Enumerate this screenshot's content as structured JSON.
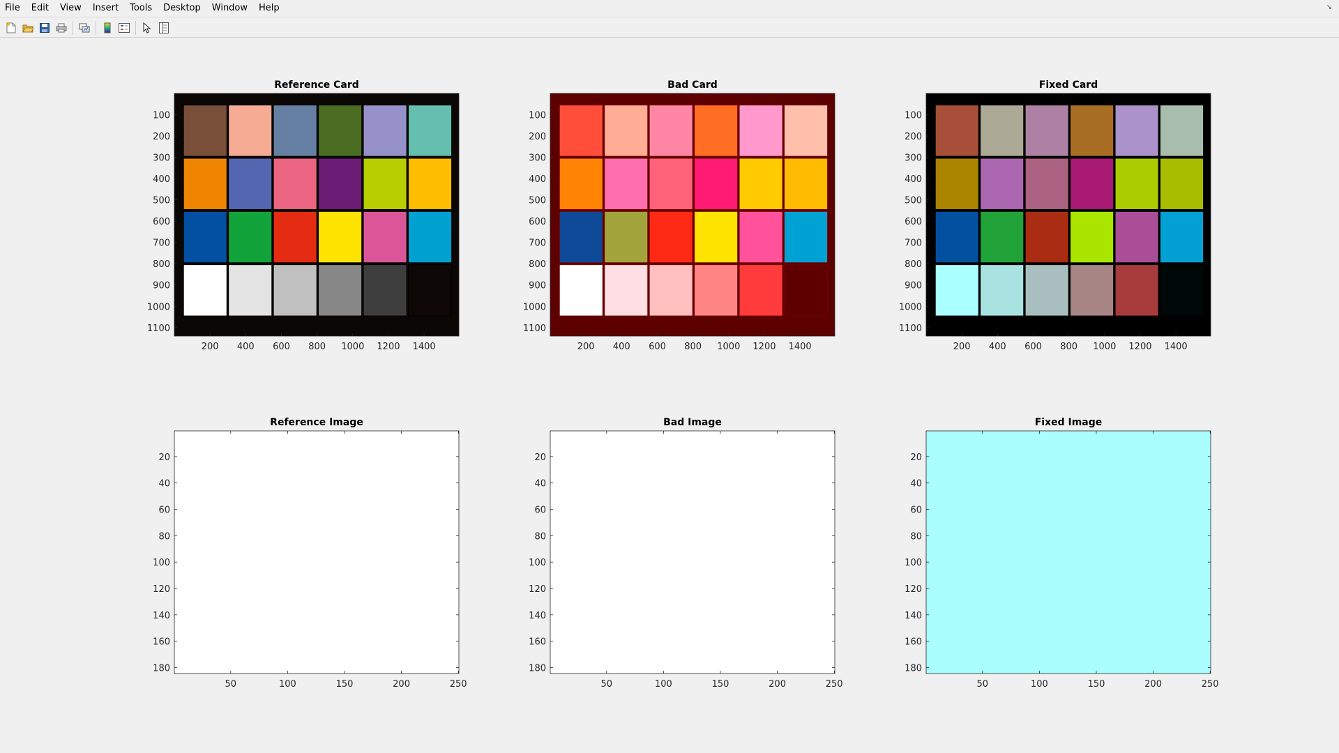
{
  "menu": [
    "File",
    "Edit",
    "View",
    "Insert",
    "Tools",
    "Desktop",
    "Window",
    "Help"
  ],
  "toolbar": {
    "buttons": [
      "new-figure-icon",
      "open-file-icon",
      "save-icon",
      "print-icon",
      "link-plot-icon",
      "colorbar-icon",
      "legend-icon",
      "pointer-icon",
      "property-inspector-icon"
    ]
  },
  "cards": [
    {
      "title": "Reference Card",
      "frame_color": "#0b0704",
      "colors": [
        [
          "#7a4f39",
          "#f6ab95",
          "#6680a4",
          "#4a6d21",
          "#9692c9",
          "#65bfae"
        ],
        [
          "#ef8500",
          "#5566b0",
          "#eb6482",
          "#6b1c74",
          "#b8ce00",
          "#ffbd00"
        ],
        [
          "#034fa1",
          "#12a33b",
          "#e32c12",
          "#ffe300",
          "#db5699",
          "#00a1d1"
        ],
        [
          "#ffffff",
          "#e4e4e4",
          "#c0c0c0",
          "#878787",
          "#3e3e3e",
          "#0d0805"
        ]
      ],
      "xticks": [
        "200",
        "400",
        "600",
        "800",
        "1000",
        "1200",
        "1400"
      ],
      "yticks": [
        "100",
        "200",
        "300",
        "400",
        "500",
        "600",
        "700",
        "800",
        "900",
        "1000",
        "1100"
      ]
    },
    {
      "title": "Bad Card",
      "frame_color": "#5c0000",
      "colors": [
        [
          "#ff4f3b",
          "#ffad95",
          "#ff87a5",
          "#ff6e22",
          "#ff99cd",
          "#ffbfab"
        ],
        [
          "#ff8304",
          "#ff6eae",
          "#ff6279",
          "#ff1a74",
          "#ffca00",
          "#ffbc00"
        ],
        [
          "#0f4a99",
          "#a2a43c",
          "#ff2a15",
          "#ffe300",
          "#ff529a",
          "#00a1d3"
        ],
        [
          "#ffffff",
          "#ffdfe3",
          "#ffbfbf",
          "#ff8585",
          "#ff3b3b",
          "#5f0000"
        ]
      ],
      "xticks": [
        "200",
        "400",
        "600",
        "800",
        "1000",
        "1200",
        "1400"
      ],
      "yticks": [
        "100",
        "200",
        "300",
        "400",
        "500",
        "600",
        "700",
        "800",
        "900",
        "1000",
        "1100"
      ]
    },
    {
      "title": "Fixed Card",
      "frame_color": "#000000",
      "colors": [
        [
          "#a84f39",
          "#aca996",
          "#ac81a3",
          "#a86e23",
          "#ac92ca",
          "#a9bdac"
        ],
        [
          "#ab8400",
          "#ab68b0",
          "#ac6281",
          "#a91a75",
          "#abcd00",
          "#a9bd00"
        ],
        [
          "#034fa0",
          "#22a33a",
          "#a92c13",
          "#aae500",
          "#aa4f97",
          "#03a1d3"
        ],
        [
          "#aaffff",
          "#a9e3e1",
          "#a9bfbf",
          "#a88585",
          "#a83c3c",
          "#000807"
        ]
      ],
      "xticks": [
        "200",
        "400",
        "600",
        "800",
        "1000",
        "1200",
        "1400"
      ],
      "yticks": [
        "100",
        "200",
        "300",
        "400",
        "500",
        "600",
        "700",
        "800",
        "900",
        "1000",
        "1100"
      ]
    }
  ],
  "images": [
    {
      "title": "Reference Image",
      "fill": "#ffffff"
    },
    {
      "title": "Bad Image",
      "fill": "#ffffff"
    },
    {
      "title": "Fixed Image",
      "fill": "#aafefe"
    }
  ],
  "image_ticks": {
    "xticks": [
      "50",
      "100",
      "150",
      "200",
      "250"
    ],
    "yticks": [
      "20",
      "40",
      "60",
      "80",
      "100",
      "120",
      "140",
      "160",
      "180"
    ]
  }
}
